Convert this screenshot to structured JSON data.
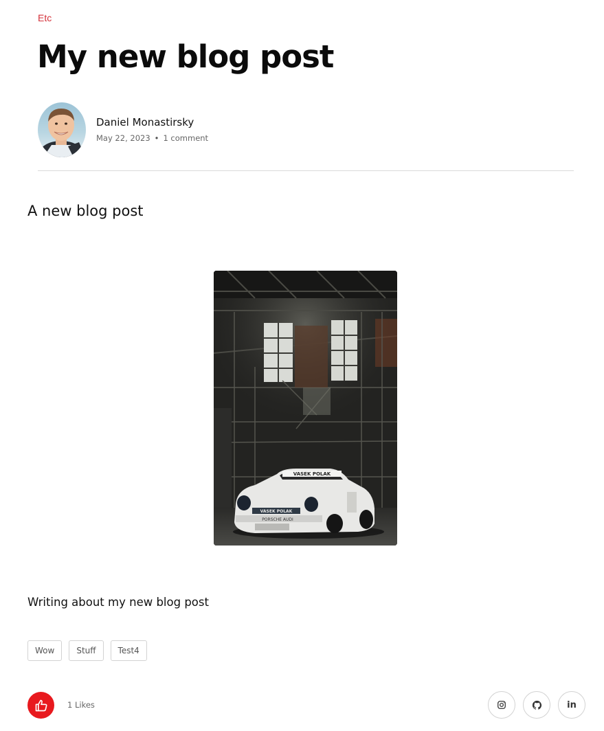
{
  "post": {
    "category": "Etc",
    "title": "My new blog post",
    "author": {
      "name": "Daniel Monastirsky",
      "date": "May 22, 2023",
      "comments": "1 comment"
    },
    "lead": "A new blog post",
    "body": "Writing about my new blog post",
    "image_text": {
      "windshield_banner": "VASEK POLAK",
      "hood_banner": "VASEK POLAK",
      "bumper_text": "PORSCHE AUDI"
    }
  },
  "tags": [
    "Wow",
    "Stuff",
    "Test4"
  ],
  "likes": {
    "count_label": "1 Likes",
    "icon": "thumbs-up-icon"
  },
  "social": [
    {
      "icon": "instagram-icon"
    },
    {
      "icon": "github-icon"
    },
    {
      "icon": "linkedin-icon",
      "label": "in"
    }
  ],
  "colors": {
    "accent": "#d4313a",
    "like_button": "#e8191e",
    "divider": "#d9d9d9"
  }
}
